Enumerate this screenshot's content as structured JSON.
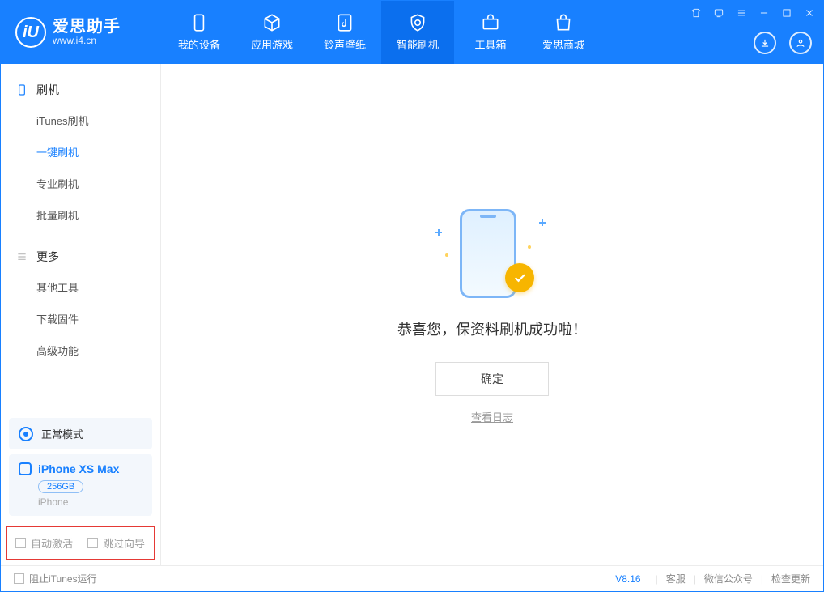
{
  "app": {
    "name_cn": "爱思助手",
    "url": "www.i4.cn"
  },
  "nav": {
    "items": [
      {
        "label": "我的设备"
      },
      {
        "label": "应用游戏"
      },
      {
        "label": "铃声壁纸"
      },
      {
        "label": "智能刷机"
      },
      {
        "label": "工具箱"
      },
      {
        "label": "爱思商城"
      }
    ],
    "active_index": 3
  },
  "sidebar": {
    "section1": {
      "title": "刷机",
      "items": [
        {
          "label": "iTunes刷机"
        },
        {
          "label": "一键刷机"
        },
        {
          "label": "专业刷机"
        },
        {
          "label": "批量刷机"
        }
      ],
      "active_index": 1
    },
    "section2": {
      "title": "更多",
      "items": [
        {
          "label": "其他工具"
        },
        {
          "label": "下载固件"
        },
        {
          "label": "高级功能"
        }
      ]
    },
    "mode_label": "正常模式",
    "device": {
      "name": "iPhone XS Max",
      "capacity": "256GB",
      "type": "iPhone"
    },
    "checkboxes": {
      "auto_activate": "自动激活",
      "skip_guide": "跳过向导"
    }
  },
  "main": {
    "message": "恭喜您，保资料刷机成功啦！",
    "ok_label": "确定",
    "log_link": "查看日志"
  },
  "footer": {
    "block_itunes": "阻止iTunes运行",
    "version": "V8.16",
    "links": {
      "support": "客服",
      "wechat": "微信公众号",
      "update": "检查更新"
    }
  }
}
